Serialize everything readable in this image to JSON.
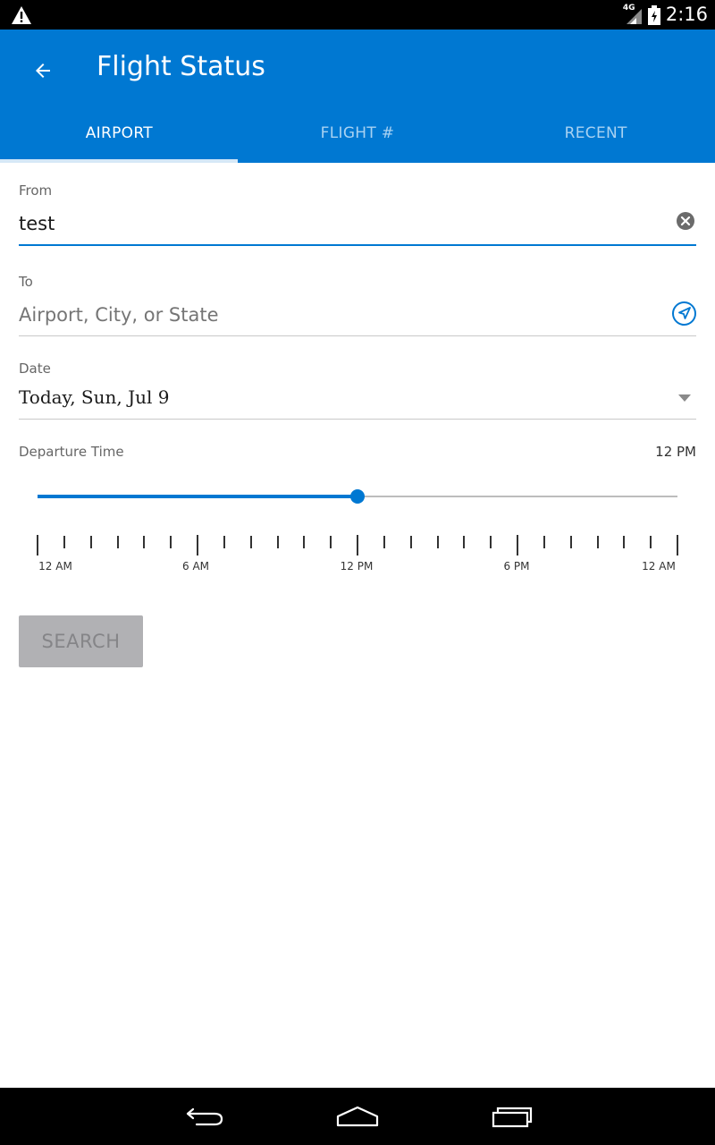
{
  "status_bar": {
    "network": "4G",
    "time": "2:16"
  },
  "app_bar": {
    "title": "Flight Status",
    "color": "#0078d2"
  },
  "tabs": [
    {
      "label": "AIRPORT",
      "active": true
    },
    {
      "label": "FLIGHT #",
      "active": false
    },
    {
      "label": "RECENT",
      "active": false
    }
  ],
  "form": {
    "from": {
      "label": "From",
      "value": "test"
    },
    "to": {
      "label": "To",
      "placeholder": "Airport, City, or State",
      "value": ""
    },
    "date": {
      "label": "Date",
      "value": "Today, Sun, Jul 9"
    },
    "departure_time": {
      "label": "Departure Time",
      "value": "12 PM",
      "slider_fraction": 0.5,
      "tick_labels": [
        "12 AM",
        "6 AM",
        "12 PM",
        "6 PM",
        "12 AM"
      ]
    }
  },
  "search_button": {
    "label": "SEARCH",
    "enabled": false
  },
  "icons": {
    "back": "arrow-back-icon",
    "clear": "clear-circle-icon",
    "locate": "location-arrow-icon",
    "dropdown": "caret-down-icon"
  }
}
